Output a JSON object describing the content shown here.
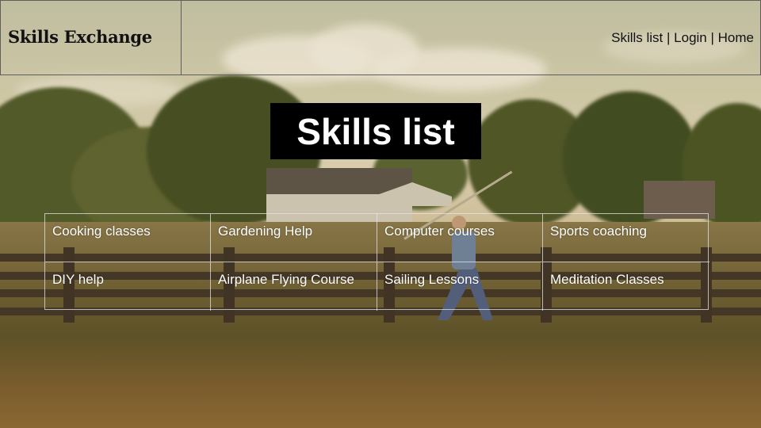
{
  "header": {
    "brand": "Skills Exchange",
    "nav": [
      {
        "label": "Skills list"
      },
      {
        "label": "Login"
      },
      {
        "label": "Home"
      }
    ],
    "separator": " | "
  },
  "title": "Skills list",
  "skills": [
    "Cooking classes",
    "Gardening Help",
    "Computer courses",
    "Sports coaching",
    "DIY help",
    "Airplane Flying Course",
    "Sailing Lessons",
    "Meditation Classes"
  ],
  "colors": {
    "title_bg": "#000000",
    "title_text": "#ffffff",
    "header_text": "#111111",
    "cell_text": "#ffffff"
  }
}
